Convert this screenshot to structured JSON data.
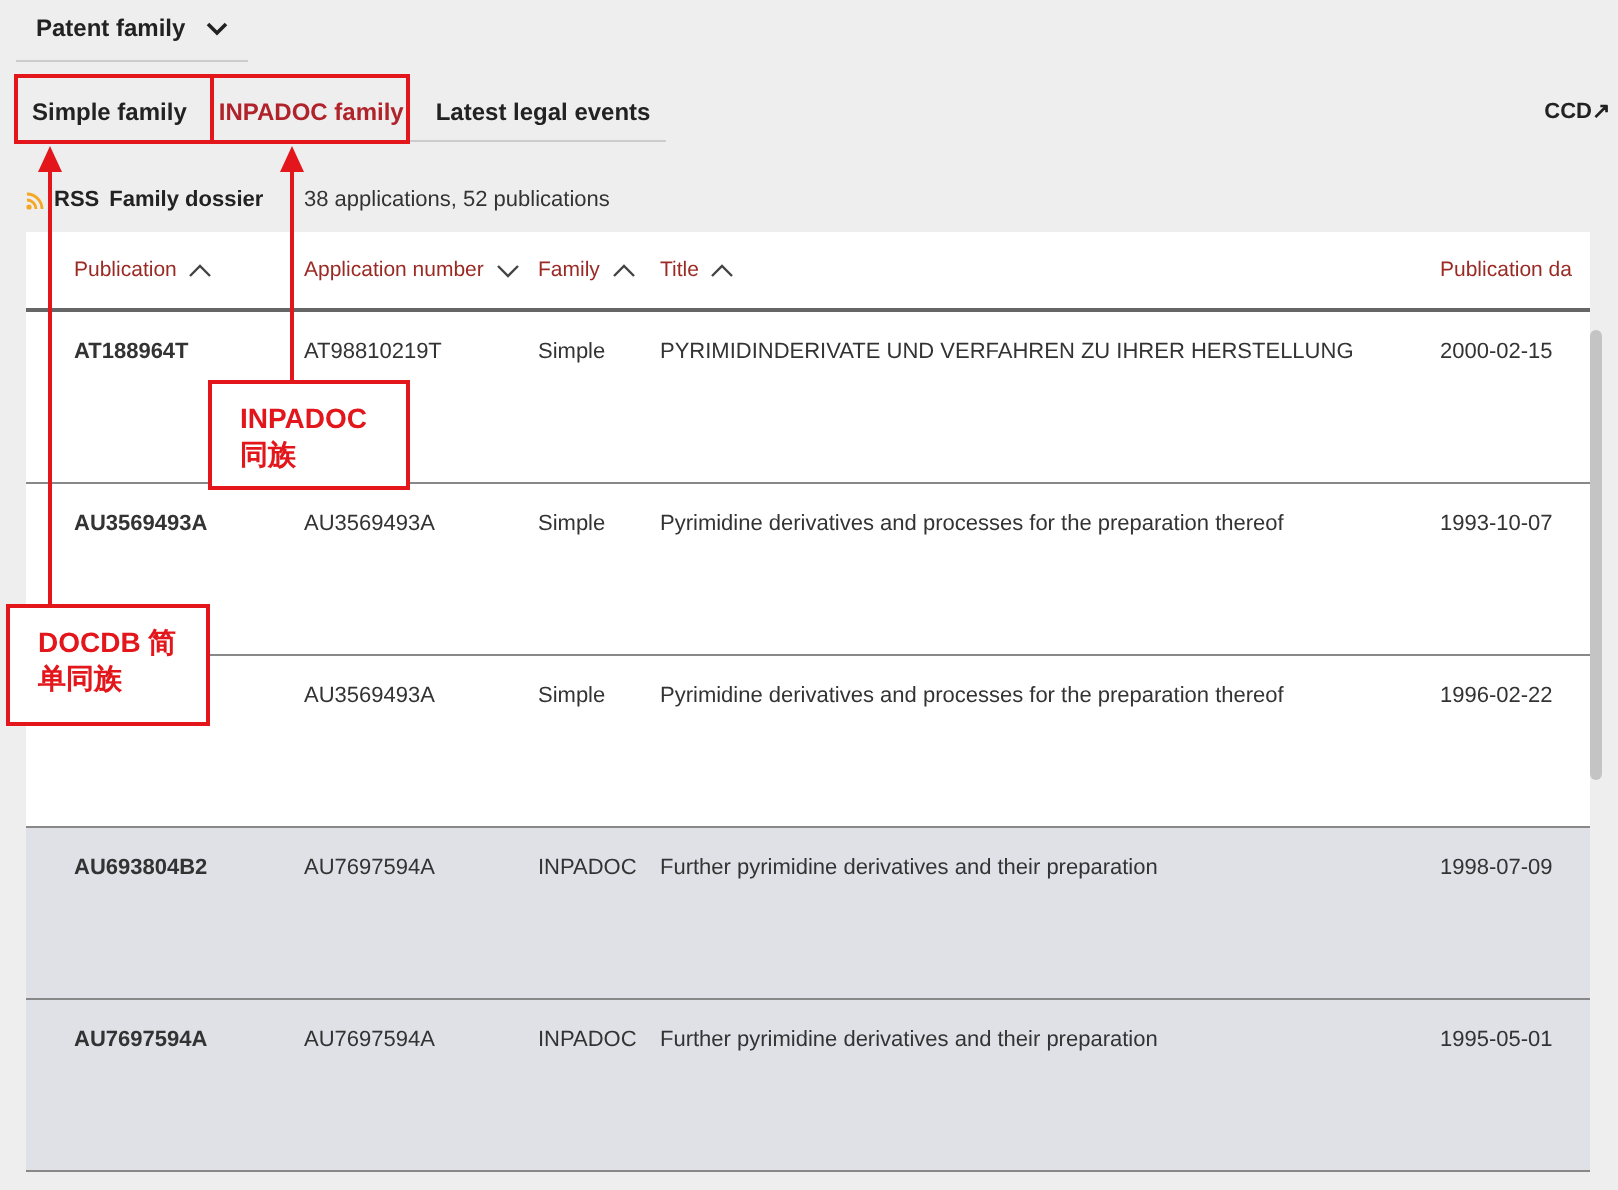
{
  "dropdown": {
    "label": "Patent family"
  },
  "tabs": [
    {
      "label": "Simple family",
      "selected": false
    },
    {
      "label": "INPADOC family",
      "selected": true
    },
    {
      "label": "Latest legal events",
      "selected": false
    }
  ],
  "ccd_link": "CCD↗",
  "rss": {
    "label": "RSS",
    "title": "Family dossier",
    "summary": "38 applications, 52 publications"
  },
  "table": {
    "columns": [
      {
        "label": "Publication",
        "sort_ascending": true
      },
      {
        "label": "Application number",
        "sort_ascending": false
      },
      {
        "label": "Family",
        "sort_ascending": true
      },
      {
        "label": "Title",
        "sort_ascending": true
      },
      {
        "label": "Publication da"
      }
    ],
    "rows": [
      {
        "highlighted": false,
        "cells": [
          "AT188964T",
          "AT98810219T",
          "Simple",
          "PYRIMIDINDERIVATE UND VERFAHREN ZU IHRER HERSTELLUNG",
          "2000-02-15"
        ]
      },
      {
        "highlighted": false,
        "cells": [
          "AU3569493A",
          "AU3569493A",
          "Simple",
          "Pyrimidine derivatives and processes for the preparation thereof",
          "1993-10-07"
        ]
      },
      {
        "highlighted": false,
        "cells": [
          null,
          "AU3569493A",
          "Simple",
          "Pyrimidine derivatives and processes for the preparation thereof",
          "1996-02-22"
        ]
      },
      {
        "highlighted": true,
        "cells": [
          "AU693804B2",
          "AU7697594A",
          "INPADOC",
          "Further pyrimidine derivatives and their preparation",
          "1998-07-09"
        ]
      },
      {
        "highlighted": true,
        "cells": [
          "AU7697594A",
          "AU7697594A",
          "INPADOC",
          "Further pyrimidine derivatives and their preparation",
          "1995-05-01"
        ]
      }
    ]
  },
  "annotations": [
    {
      "text": "INPADOC 同族"
    },
    {
      "text": "DOCDB 简单同族"
    }
  ]
}
